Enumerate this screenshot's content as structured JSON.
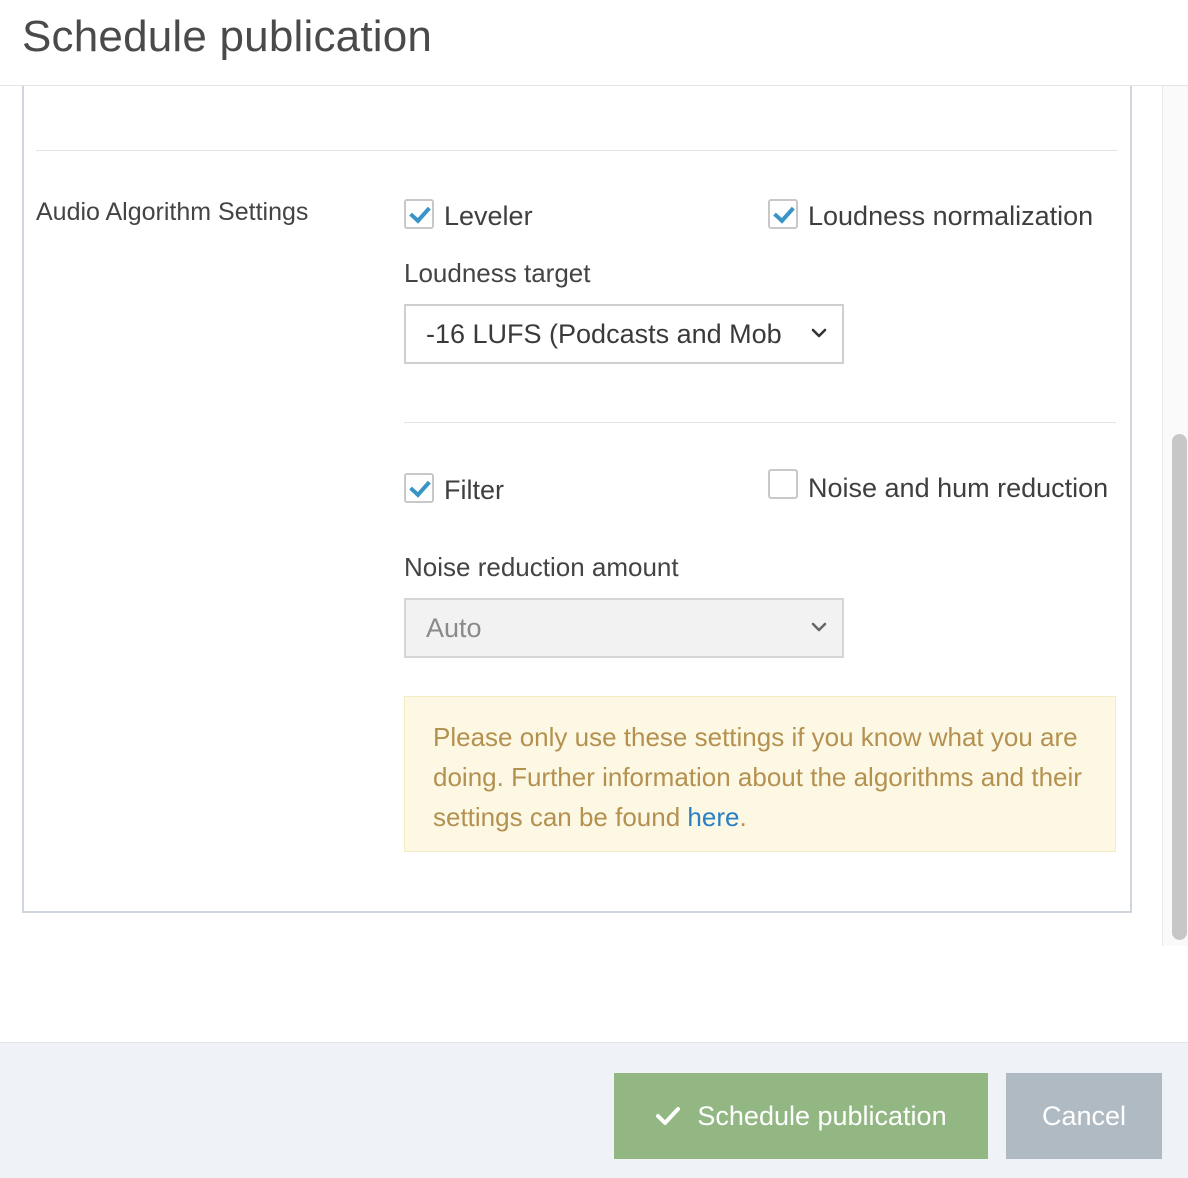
{
  "header": {
    "title": "Schedule publication"
  },
  "section": {
    "label": "Audio Algorithm Settings"
  },
  "leveler": {
    "label": "Leveler",
    "checked": true
  },
  "loudness_normalization": {
    "label": "Loudness normalization",
    "checked": true
  },
  "loudness_target": {
    "label": "Loudness target",
    "selected": "-16 LUFS (Podcasts and Mob"
  },
  "filter": {
    "label": "Filter",
    "checked": true
  },
  "noise_hum": {
    "label": "Noise and hum reduction",
    "checked": false
  },
  "noise_amount": {
    "label": "Noise reduction amount",
    "selected": "Auto",
    "disabled": true
  },
  "warning": {
    "text": "Please only use these settings if you know what you are doing. Further information about the algorithms and their settings can be found ",
    "link_text": "here",
    "suffix": "."
  },
  "footer": {
    "primary_label": "Schedule publication",
    "secondary_label": "Cancel"
  },
  "colors": {
    "primary_button": "#92b783",
    "secondary_button": "#afbac3",
    "checkbox_check": "#3a95c7",
    "warning_bg": "#fcf8e3",
    "warning_text": "#b49150",
    "link": "#2b7fc3"
  },
  "icons": {
    "checkmark": "check-icon",
    "dropdown": "chevron-down-icon"
  }
}
